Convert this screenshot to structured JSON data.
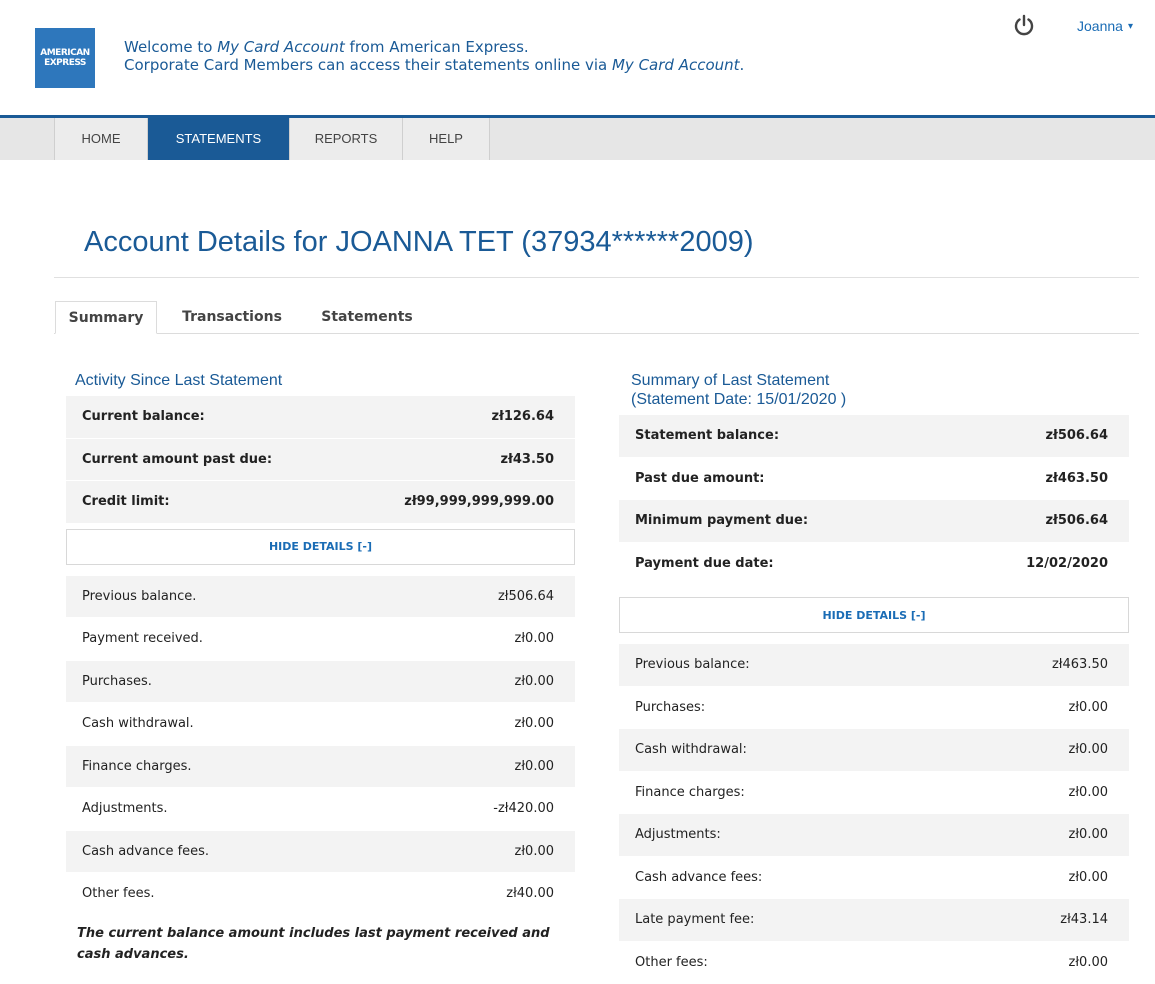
{
  "header": {
    "logo_line1": "AMERICAN",
    "logo_line2": "EXPRESS",
    "welcome_line1_pre": "Welcome to ",
    "welcome_line1_em": "My Card Account",
    "welcome_line1_post": " from American Express.",
    "welcome_line2_pre": "Corporate Card Members can access their statements online via ",
    "welcome_line2_em": "My Card Account",
    "welcome_line2_post": ".",
    "user_name": "Joanna",
    "user_caret": "▾"
  },
  "nav": {
    "tabs": [
      {
        "label": "HOME"
      },
      {
        "label": "STATEMENTS",
        "active": true
      },
      {
        "label": "REPORTS"
      },
      {
        "label": "HELP"
      }
    ]
  },
  "page": {
    "title": "Account Details for JOANNA TET (37934******2009)"
  },
  "subtabs": [
    {
      "label": "Summary",
      "active": true
    },
    {
      "label": "Transactions"
    },
    {
      "label": "Statements"
    }
  ],
  "activity": {
    "heading": "Activity Since Last Statement",
    "summary_rows": [
      {
        "label": "Current balance:",
        "value": "zł126.64"
      },
      {
        "label": "Current amount past due:",
        "value": "zł43.50"
      },
      {
        "label": "Credit limit:",
        "value": "zł99,999,999,999.00"
      }
    ],
    "hide_details": "HIDE DETAILS [-]",
    "detail_rows": [
      {
        "label": "Previous balance.",
        "value": "zł506.64"
      },
      {
        "label": "Payment received.",
        "value": "zł0.00"
      },
      {
        "label": "Purchases.",
        "value": "zł0.00"
      },
      {
        "label": "Cash withdrawal.",
        "value": "zł0.00"
      },
      {
        "label": "Finance charges.",
        "value": "zł0.00"
      },
      {
        "label": "Adjustments.",
        "value": "-zł420.00"
      },
      {
        "label": "Cash advance fees.",
        "value": "zł0.00"
      },
      {
        "label": "Other fees.",
        "value": "zł40.00"
      }
    ],
    "note": "The current balance amount includes last payment received and cash advances."
  },
  "last_statement": {
    "heading_line1": "Summary of Last Statement",
    "heading_line2": "(Statement Date: 15/01/2020 )",
    "summary_rows": [
      {
        "label": "Statement balance:",
        "value": "zł506.64"
      },
      {
        "label": "Past due amount:",
        "value": "zł463.50"
      },
      {
        "label": "Minimum payment due:",
        "value": "zł506.64"
      },
      {
        "label": "Payment due date:",
        "value": "12/02/2020"
      }
    ],
    "hide_details": "HIDE DETAILS [-]",
    "detail_rows": [
      {
        "label": "Previous balance:",
        "value": "zł463.50"
      },
      {
        "label": "Purchases:",
        "value": "zł0.00"
      },
      {
        "label": "Cash withdrawal:",
        "value": "zł0.00"
      },
      {
        "label": "Finance charges:",
        "value": "zł0.00"
      },
      {
        "label": "Adjustments:",
        "value": "zł0.00"
      },
      {
        "label": "Cash advance fees:",
        "value": "zł0.00"
      },
      {
        "label": "Late payment fee:",
        "value": "zł43.14"
      },
      {
        "label": "Other fees:",
        "value": "zł0.00"
      }
    ]
  }
}
